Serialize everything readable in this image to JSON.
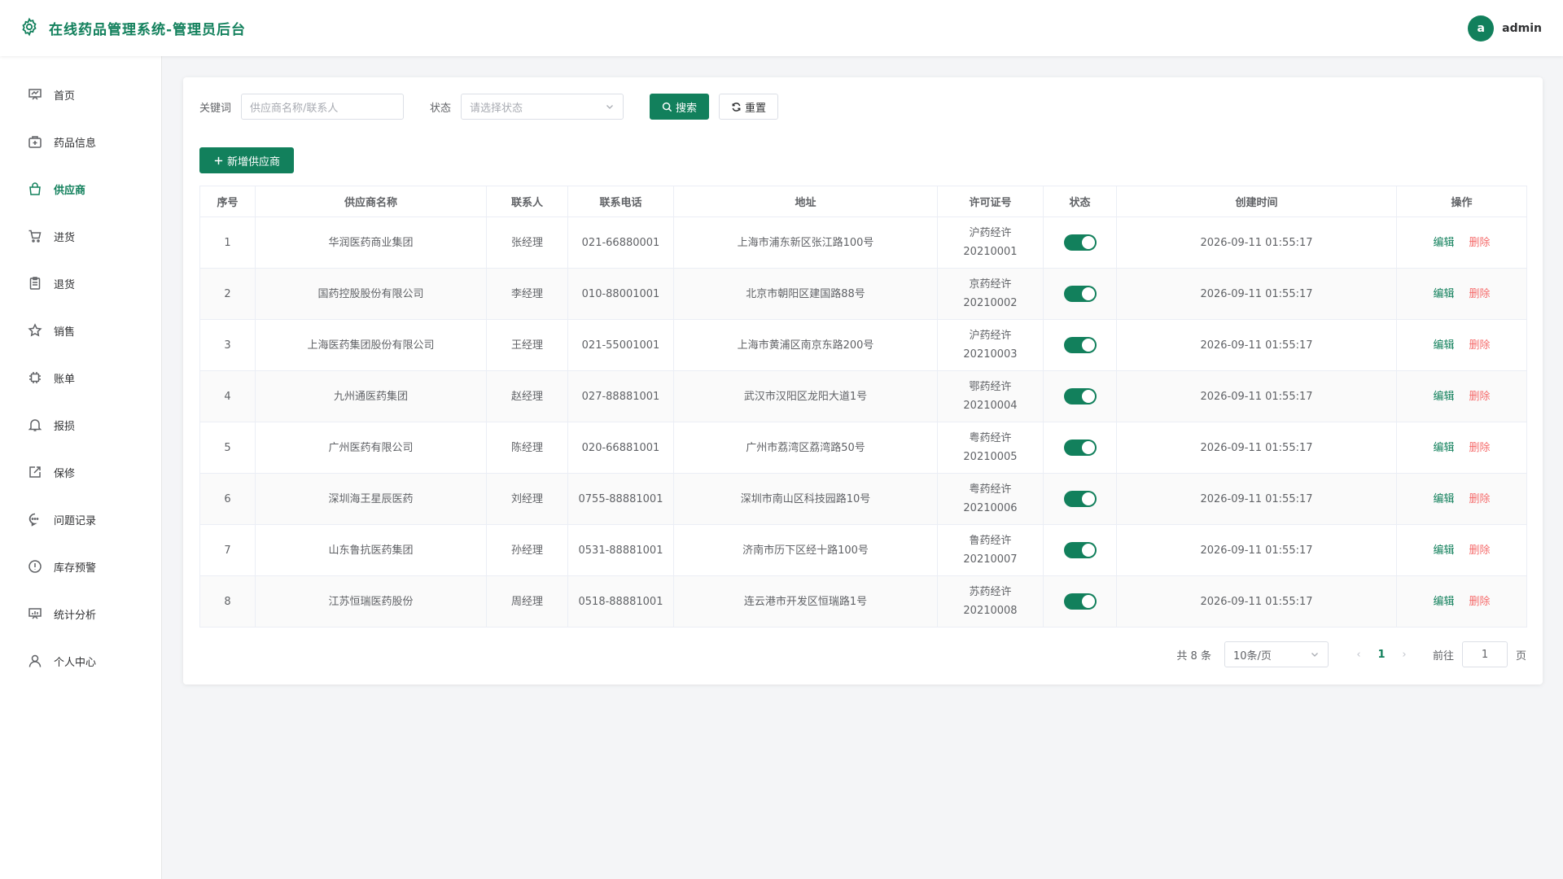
{
  "header": {
    "title": "在线药品管理系统-管理员后台",
    "avatar_letter": "a",
    "username": "admin"
  },
  "sidebar": {
    "items": [
      {
        "label": "首页",
        "icon": "dashboard-icon"
      },
      {
        "label": "药品信息",
        "icon": "medkit-icon"
      },
      {
        "label": "供应商",
        "icon": "bag-icon",
        "active": true
      },
      {
        "label": "进货",
        "icon": "cart-icon"
      },
      {
        "label": "退货",
        "icon": "clipboard-icon"
      },
      {
        "label": "销售",
        "icon": "star-icon"
      },
      {
        "label": "账单",
        "icon": "chip-icon"
      },
      {
        "label": "报损",
        "icon": "bell-icon"
      },
      {
        "label": "保修",
        "icon": "edit-box-icon"
      },
      {
        "label": "问题记录",
        "icon": "chat-icon"
      },
      {
        "label": "库存预警",
        "icon": "warning-icon"
      },
      {
        "label": "统计分析",
        "icon": "chart-board-icon"
      },
      {
        "label": "个人中心",
        "icon": "user-icon"
      }
    ]
  },
  "filters": {
    "keyword_label": "关键词",
    "keyword_placeholder": "供应商名称/联系人",
    "status_label": "状态",
    "status_placeholder": "请选择状态",
    "search_label": "搜索",
    "reset_label": "重置"
  },
  "add_label": "新增供应商",
  "table": {
    "headers": [
      "序号",
      "供应商名称",
      "联系人",
      "联系电话",
      "地址",
      "许可证号",
      "状态",
      "创建时间",
      "操作"
    ],
    "edit_label": "编辑",
    "delete_label": "删除",
    "rows": [
      {
        "no": "1",
        "name": "华润医药商业集团",
        "contact": "张经理",
        "phone": "021-66880001",
        "address": "上海市浦东新区张江路100号",
        "license1": "沪药经许",
        "license2": "20210001",
        "enabled": true,
        "created": "2026-09-11 01:55:17"
      },
      {
        "no": "2",
        "name": "国药控股股份有限公司",
        "contact": "李经理",
        "phone": "010-88001001",
        "address": "北京市朝阳区建国路88号",
        "license1": "京药经许",
        "license2": "20210002",
        "enabled": true,
        "created": "2026-09-11 01:55:17"
      },
      {
        "no": "3",
        "name": "上海医药集团股份有限公司",
        "contact": "王经理",
        "phone": "021-55001001",
        "address": "上海市黄浦区南京东路200号",
        "license1": "沪药经许",
        "license2": "20210003",
        "enabled": true,
        "created": "2026-09-11 01:55:17"
      },
      {
        "no": "4",
        "name": "九州通医药集团",
        "contact": "赵经理",
        "phone": "027-88881001",
        "address": "武汉市汉阳区龙阳大道1号",
        "license1": "鄂药经许",
        "license2": "20210004",
        "enabled": true,
        "created": "2026-09-11 01:55:17"
      },
      {
        "no": "5",
        "name": "广州医药有限公司",
        "contact": "陈经理",
        "phone": "020-66881001",
        "address": "广州市荔湾区荔湾路50号",
        "license1": "粤药经许",
        "license2": "20210005",
        "enabled": true,
        "created": "2026-09-11 01:55:17"
      },
      {
        "no": "6",
        "name": "深圳海王星辰医药",
        "contact": "刘经理",
        "phone": "0755-88881001",
        "address": "深圳市南山区科技园路10号",
        "license1": "粤药经许",
        "license2": "20210006",
        "enabled": true,
        "created": "2026-09-11 01:55:17"
      },
      {
        "no": "7",
        "name": "山东鲁抗医药集团",
        "contact": "孙经理",
        "phone": "0531-88881001",
        "address": "济南市历下区经十路100号",
        "license1": "鲁药经许",
        "license2": "20210007",
        "enabled": true,
        "created": "2026-09-11 01:55:17"
      },
      {
        "no": "8",
        "name": "江苏恒瑞医药股份",
        "contact": "周经理",
        "phone": "0518-88881001",
        "address": "连云港市开发区恒瑞路1号",
        "license1": "苏药经许",
        "license2": "20210008",
        "enabled": true,
        "created": "2026-09-11 01:55:17"
      }
    ]
  },
  "pagination": {
    "total_text": "共 8 条",
    "page_size": "10条/页",
    "current_page": "1",
    "goto_label": "前往",
    "goto_value": "1",
    "page_unit": "页"
  },
  "colors": {
    "accent": "#12805c",
    "danger": "#f56c6c"
  }
}
